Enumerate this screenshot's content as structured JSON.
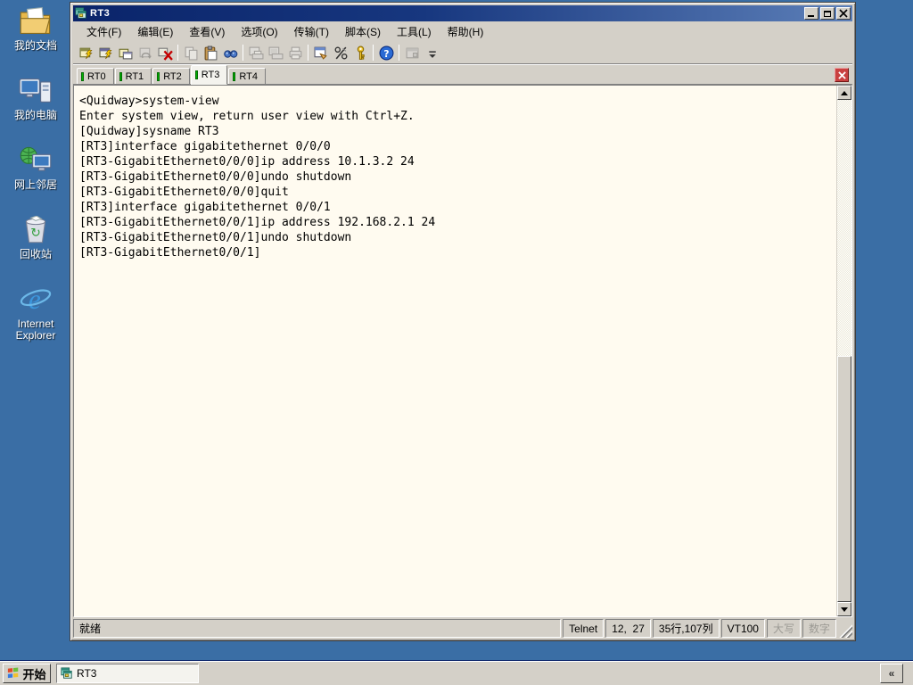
{
  "colors": {
    "desktop_bg": "#3A6EA5",
    "window_chrome": "#D4D0C8",
    "terminal_bg": "#FFFBF0",
    "title_gradient_left": "#0A246A",
    "title_gradient_right": "#5C7FB8",
    "tab_indicator_green": "#00B400",
    "tab_close_red": "#C94040"
  },
  "desktop_icons": [
    {
      "name": "my-documents",
      "label": "我的文档"
    },
    {
      "name": "my-computer",
      "label": "我的电脑"
    },
    {
      "name": "network-places",
      "label": "网上邻居"
    },
    {
      "name": "recycle-bin",
      "label": "回收站"
    },
    {
      "name": "internet-explorer",
      "label": "Internet Explorer"
    }
  ],
  "window": {
    "title": "RT3",
    "menu_items": [
      "文件(F)",
      "编辑(E)",
      "查看(V)",
      "选项(O)",
      "传输(T)",
      "脚本(S)",
      "工具(L)",
      "帮助(H)"
    ],
    "toolbar_buttons": [
      {
        "name": "quick-connect-icon",
        "enabled": true
      },
      {
        "name": "connect-icon",
        "enabled": true
      },
      {
        "name": "connect-in-tab-icon",
        "enabled": true
      },
      {
        "name": "reconnect-icon",
        "enabled": false
      },
      {
        "name": "disconnect-icon",
        "enabled": true
      },
      {
        "name": "copy-icon",
        "enabled": false
      },
      {
        "name": "paste-icon",
        "enabled": true
      },
      {
        "name": "find-icon",
        "enabled": true
      },
      {
        "name": "print-screen-icon",
        "enabled": false
      },
      {
        "name": "print-selection-icon",
        "enabled": false
      },
      {
        "name": "print-icon",
        "enabled": false
      },
      {
        "name": "session-options-icon",
        "enabled": true
      },
      {
        "name": "global-options-icon",
        "enabled": true
      },
      {
        "name": "keymap-icon",
        "enabled": true
      },
      {
        "name": "help-icon",
        "enabled": true
      },
      {
        "name": "app-window-icon",
        "enabled": false
      },
      {
        "name": "toolbar-overflow-icon",
        "enabled": true
      }
    ],
    "session_tabs": [
      {
        "label": "RT0",
        "active": false
      },
      {
        "label": "RT1",
        "active": false
      },
      {
        "label": "RT2",
        "active": false
      },
      {
        "label": "RT3",
        "active": true
      },
      {
        "label": "RT4",
        "active": false
      }
    ],
    "terminal_lines": [
      "<Quidway>system-view",
      "Enter system view, return user view with Ctrl+Z.",
      "[Quidway]sysname RT3",
      "[RT3]interface gigabitethernet 0/0/0",
      "[RT3-GigabitEthernet0/0/0]ip address 10.1.3.2 24",
      "[RT3-GigabitEthernet0/0/0]undo shutdown",
      "[RT3-GigabitEthernet0/0/0]quit",
      "[RT3]interface gigabitethernet 0/0/1",
      "[RT3-GigabitEthernet0/0/1]ip address 192.168.2.1 24",
      "[RT3-GigabitEthernet0/0/1]undo shutdown",
      "[RT3-GigabitEthernet0/0/1]"
    ],
    "status_bar": {
      "ready": "就绪",
      "protocol": "Telnet",
      "cursor_pos": "12,  27",
      "term_size": "35行,107列",
      "emulation": "VT100",
      "caps_lock": "大写",
      "num_lock": "数字"
    }
  },
  "taskbar": {
    "start_label": "开始",
    "tasks": [
      {
        "label": "RT3"
      }
    ],
    "tray_collapse": "«"
  }
}
